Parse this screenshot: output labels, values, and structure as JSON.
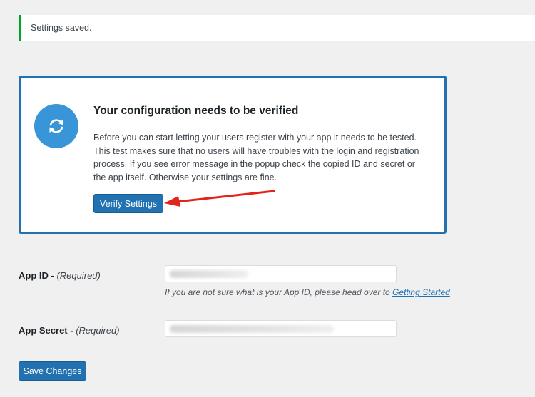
{
  "notice": {
    "text": "Settings saved."
  },
  "verify": {
    "title": "Your configuration needs to be verified",
    "description": "Before you can start letting your users register with your app it needs to be tested. This test makes sure that no users will have troubles with the login and registration process. If you see error message in the popup check the copied ID and secret or the app itself. Otherwise your settings are fine.",
    "button_label": "Verify Settings",
    "icon": "sync-icon",
    "accent_color": "#2271b1",
    "arrow_color": "#e3241b"
  },
  "fields": {
    "app_id": {
      "label": "App ID -",
      "required_label": "(Required)",
      "value": "",
      "hint_prefix": "If you are not sure what is your App ID, please head over to",
      "hint_link": "Getting Started"
    },
    "app_secret": {
      "label": "App Secret -",
      "required_label": "(Required)",
      "value": ""
    }
  },
  "save_button_label": "Save Changes"
}
